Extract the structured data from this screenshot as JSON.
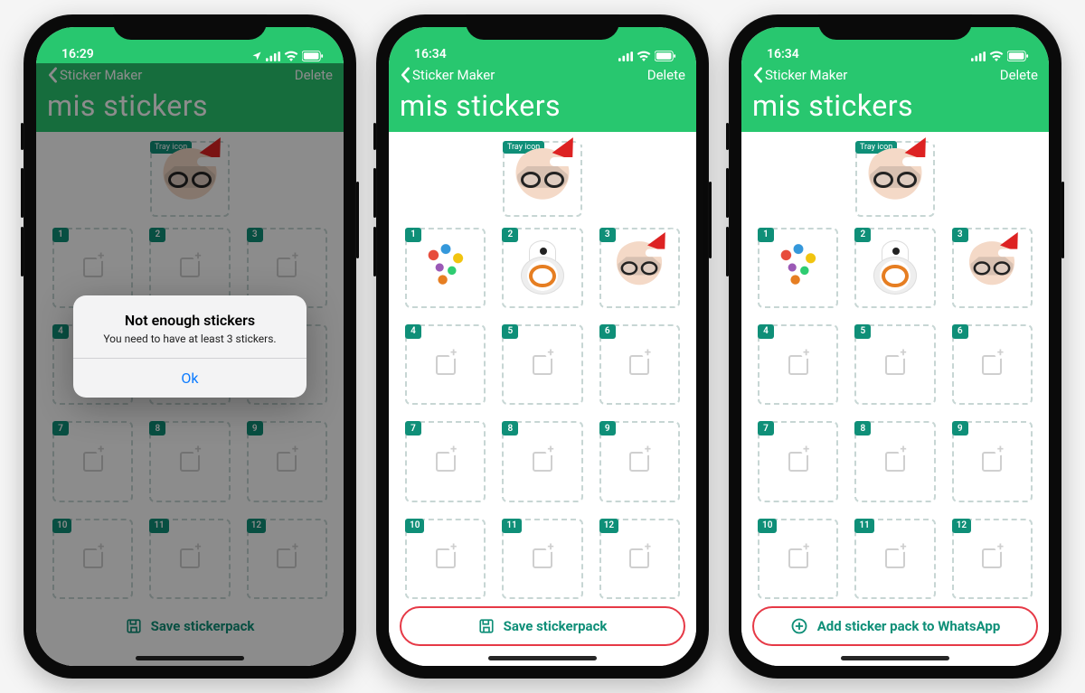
{
  "phones": [
    {
      "time": "16:29",
      "back_label": "Sticker Maker",
      "delete_label": "Delete",
      "page_title": "mis stickers",
      "tray_badge": "Tray icon",
      "slot_count": 12,
      "filled_slots": [],
      "action_label": "Save stickerpack",
      "action_icon": "save-icon",
      "action_highlighted": false,
      "dimmed": true,
      "modal": {
        "title": "Not enough stickers",
        "message": "You need to have at least 3 stickers.",
        "ok_label": "Ok"
      }
    },
    {
      "time": "16:34",
      "back_label": "Sticker Maker",
      "delete_label": "Delete",
      "page_title": "mis stickers",
      "tray_badge": "Tray icon",
      "slot_count": 12,
      "filled_slots": [
        1,
        2,
        3
      ],
      "action_label": "Save stickerpack",
      "action_icon": "save-icon",
      "action_highlighted": true,
      "dimmed": false,
      "modal": null
    },
    {
      "time": "16:34",
      "back_label": "Sticker Maker",
      "delete_label": "Delete",
      "page_title": "mis stickers",
      "tray_badge": "Tray icon",
      "slot_count": 12,
      "filled_slots": [
        1,
        2,
        3
      ],
      "action_label": "Add sticker pack to WhatsApp",
      "action_icon": "plus-circle-icon",
      "action_highlighted": true,
      "dimmed": false,
      "modal": null
    }
  ],
  "colors": {
    "accent": "#28c76f",
    "teal": "#0f8f78",
    "highlight": "#e63946"
  }
}
